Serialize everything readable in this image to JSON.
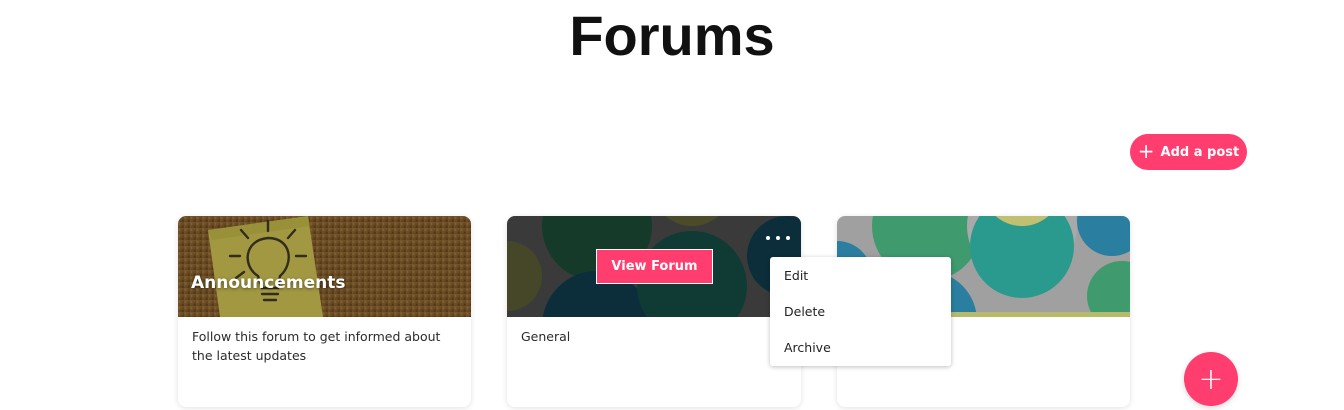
{
  "page": {
    "title": "Forums"
  },
  "colors": {
    "accent": "#ff3d6e",
    "menu_bg": "#ffffff"
  },
  "actions": {
    "add_post_label": "Add a post",
    "add_post_icon": "plus-icon",
    "fab_icon": "plus-icon",
    "fab_symbol": "+",
    "add_symbol": "+"
  },
  "forums": [
    {
      "title": "Announcements",
      "description": "Follow this forum to get informed about the latest updates",
      "cover": "sticky-note-lightbulb"
    },
    {
      "title": "",
      "description": "General",
      "cover": "geometric-pattern-dark",
      "hover_button_label": "View Forum",
      "more_icon": "more-horizontal-icon"
    },
    {
      "title": "",
      "description": "",
      "cover": "geometric-pattern"
    }
  ],
  "context_menu": {
    "items": [
      {
        "label": "Edit"
      },
      {
        "label": "Delete"
      },
      {
        "label": "Archive"
      }
    ]
  }
}
